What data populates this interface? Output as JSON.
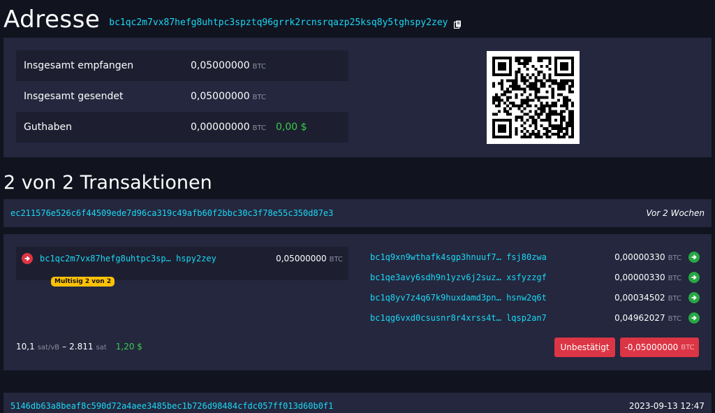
{
  "header": {
    "title": "Adresse",
    "address": "bc1qc2m7vx87hefg8uhtpc3spztq96grrk2rcnsrqazp25ksq8y5tghspy2zey"
  },
  "summary": {
    "rows": [
      {
        "label": "Insgesamt empfangen",
        "value": "0,05000000",
        "unit": "BTC"
      },
      {
        "label": "Insgesamt gesendet",
        "value": "0,05000000",
        "unit": "BTC"
      },
      {
        "label": "Guthaben",
        "value": "0,00000000",
        "unit": "BTC",
        "fiat": "0,00 $"
      }
    ]
  },
  "transactions_title": "2 von 2 Transaktionen",
  "transactions": [
    {
      "txid": "ec211576e526c6f44509ede7d96ca319c49afb60f2bbc30c3f78e55c350d87e3",
      "time": "Vor 2 Wochen",
      "input": {
        "address_start": "bc1qc2m7vx87hefg8uhtpc3sp…",
        "address_end": "hspy2zey",
        "amount": "0,05000000",
        "unit": "BTC",
        "badge": "Multisig 2 von 2"
      },
      "outputs": [
        {
          "address_start": "bc1q9xn9wthafk4sgp3hnuuf7…",
          "address_end": "fsj80zwa",
          "amount": "0,00000330",
          "unit": "BTC"
        },
        {
          "address_start": "bc1qe3avy6sdh9n1yzv6j2suz…",
          "address_end": "xsfyzzgf",
          "amount": "0,00000330",
          "unit": "BTC"
        },
        {
          "address_start": "bc1q8yv7z4q67k9huxdamd3pn…",
          "address_end": "hsnw2q6t",
          "amount": "0,00034502",
          "unit": "BTC"
        },
        {
          "address_start": "bc1qg6vxd0csusnr8r4xrss4t…",
          "address_end": "lqsp2an7",
          "amount": "0,04962027",
          "unit": "BTC"
        }
      ],
      "fee": {
        "rate": "10,1",
        "rate_unit": "sat/vB",
        "separator": "–",
        "total": "2.811",
        "total_unit": "sat",
        "fiat": "1,20 $"
      },
      "status_label": "Unbestätigt",
      "net_amount": "-0,05000000",
      "net_unit": "BTC"
    },
    {
      "txid": "5146db63a8beaf8c590d72a4aee3485bec1b726d98484cfdc057ff013d60b0f1",
      "time": "2023-09-13 12:47"
    }
  ],
  "colors": {
    "background": "#11131f",
    "panel": "#24273e",
    "panel_row": "#1d1f31",
    "link": "#1bd8f4",
    "positive": "#3bcc49",
    "danger": "#dc3545",
    "badge": "#ffc107"
  },
  "icons": {
    "copy": "copy-icon",
    "input": "arrow-right-circle-icon",
    "output": "arrow-right-circle-icon"
  }
}
